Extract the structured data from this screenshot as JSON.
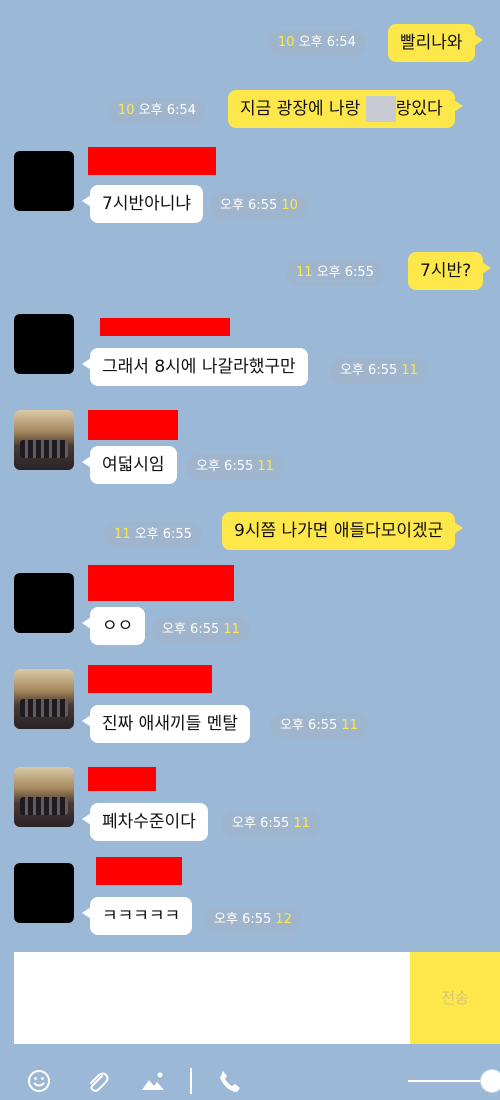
{
  "messages": [
    {
      "sender": "me",
      "text": "빨리나와",
      "time": "오후 6:54",
      "count": "10"
    },
    {
      "sender": "me",
      "text_before": "지금 광장에 나랑",
      "text_after": "랑있다",
      "time": "오후 6:54",
      "count": "10"
    },
    {
      "sender": "other",
      "text": "7시반아니냐",
      "time": "오후 6:55",
      "count": "10"
    },
    {
      "sender": "me",
      "text": "7시반?",
      "time": "오후 6:55",
      "count": "11"
    },
    {
      "sender": "other",
      "text": "그래서 8시에 나갈라했구만",
      "time": "오후 6:55",
      "count": "11"
    },
    {
      "sender": "other",
      "text": "여덟시임",
      "time": "오후 6:55",
      "count": "11"
    },
    {
      "sender": "me",
      "text": "9시쯤 나가면 애들다모이겠군",
      "time": "오후 6:55",
      "count": "11"
    },
    {
      "sender": "other",
      "text": "ㅇㅇ",
      "time": "오후 6:55",
      "count": "11"
    },
    {
      "sender": "other",
      "text": "진짜 애새끼들 멘탈",
      "time": "오후 6:55",
      "count": "11"
    },
    {
      "sender": "other",
      "text": "폐차수준이다",
      "time": "오후 6:55",
      "count": "11"
    },
    {
      "sender": "other",
      "text": "ㅋㅋㅋㅋㅋ",
      "time": "오후 6:55",
      "count": "12"
    }
  ],
  "composer": {
    "send_label": "전송"
  },
  "toolbar": {
    "icons": [
      "emoji-icon",
      "attachment-icon",
      "image-icon",
      "phone-icon"
    ]
  },
  "colors": {
    "background": "#9bb8d6",
    "my_bubble": "#fde74b",
    "other_bubble": "#ffffff",
    "redaction": "#ff0000"
  }
}
